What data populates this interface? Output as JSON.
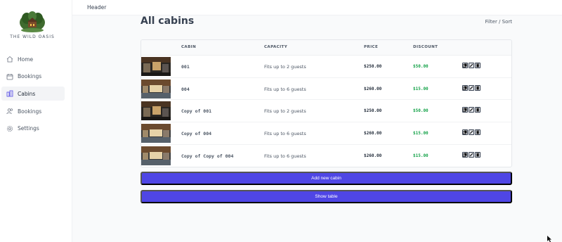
{
  "sidebar": {
    "logo_text": "THE WILD OASIS",
    "items": [
      {
        "label": "Home",
        "icon": "home-icon"
      },
      {
        "label": "Bookings",
        "icon": "calendar-icon"
      },
      {
        "label": "Cabins",
        "icon": "cabins-icon"
      },
      {
        "label": "Bookings",
        "icon": "users-icon"
      },
      {
        "label": "Settings",
        "icon": "gear-icon"
      }
    ],
    "active_index": 2
  },
  "header": {
    "text": "Header"
  },
  "main": {
    "title": "All cabins",
    "filter_sort": "Filter / Sort"
  },
  "table": {
    "columns": [
      "CABIN",
      "CAPACITY",
      "PRICE",
      "DISCOUNT"
    ],
    "rows": [
      {
        "name": "001",
        "capacity": "Fits up to 2 guests",
        "price": "$250.00",
        "discount": "$50.00"
      },
      {
        "name": "004",
        "capacity": "Fits up to 6 guests",
        "price": "$260.00",
        "discount": "$15.00"
      },
      {
        "name": "Copy of 001",
        "capacity": "Fits up to 2 guests",
        "price": "$250.00",
        "discount": "$50.00"
      },
      {
        "name": "Copy of 004",
        "capacity": "Fits up to 6 guests",
        "price": "$260.00",
        "discount": "$15.00"
      },
      {
        "name": "Copy of Copy of 004",
        "capacity": "Fits up to 6 guests",
        "price": "$260.00",
        "discount": "$15.00"
      }
    ]
  },
  "buttons": {
    "add_new": "Add new cabin",
    "show_table": "Show table"
  },
  "colors": {
    "accent": "#4f46e5",
    "discount": "#16a34a"
  }
}
